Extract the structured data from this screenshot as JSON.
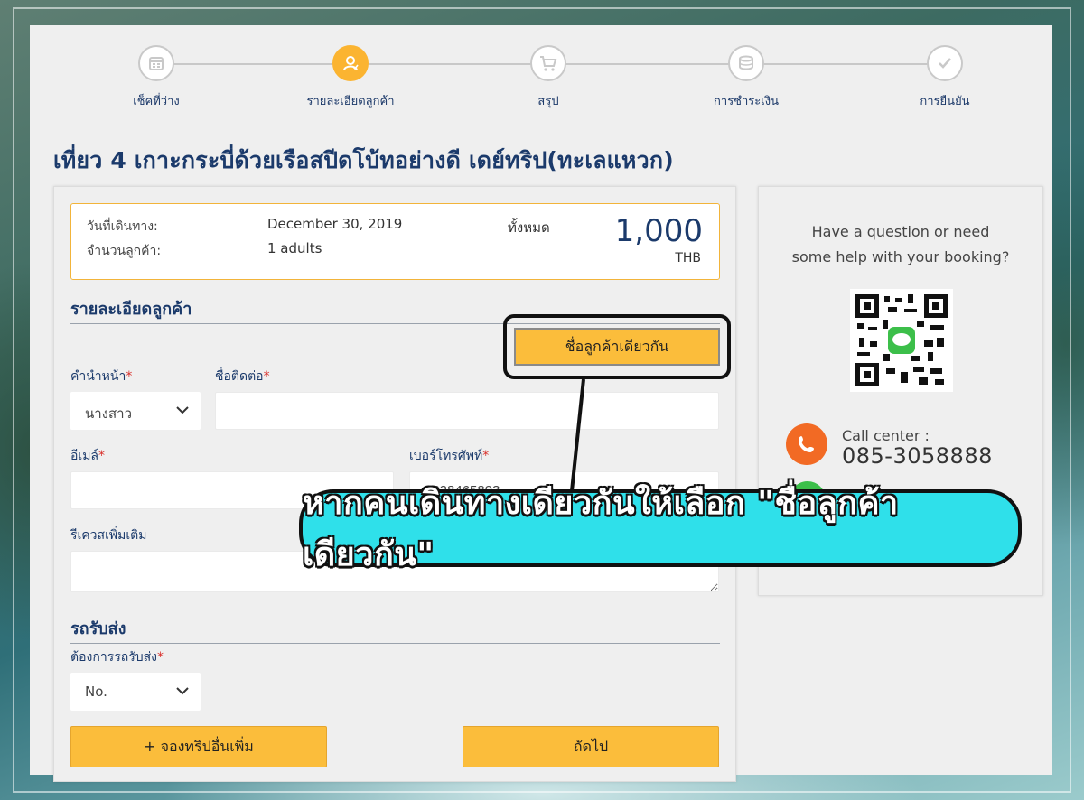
{
  "steps": [
    {
      "label": "เช็คที่ว่าง",
      "icon": "calendar-icon",
      "active": false
    },
    {
      "label": "รายละเอียดลูกค้า",
      "icon": "user-icon",
      "active": true
    },
    {
      "label": "สรุป",
      "icon": "cart-icon",
      "active": false
    },
    {
      "label": "การชำระเงิน",
      "icon": "coins-icon",
      "active": false
    },
    {
      "label": "การยืนยัน",
      "icon": "check-icon",
      "active": false
    }
  ],
  "title": "เที่ยว 4 เกาะกระบี่ด้วยเรือสปีดโบ้ทอย่างดี เดย์ทริป(ทะเลแหวก)",
  "summary": {
    "date_label": "วันที่เดินทาง:",
    "date_value": "December 30, 2019",
    "guests_label": "จำนวนลูกค้า:",
    "guests_value": "1 adults",
    "total_label": "ทั้งหมด",
    "price": "1,000",
    "currency": "THB"
  },
  "customer": {
    "section_title": "รายละเอียดลูกค้า",
    "same_name_button": "ชื่อลูกค้าเดียวกัน",
    "prefix_label": "คำนำหน้า",
    "prefix_value": "นางสาว",
    "contact_name_label": "ชื่อติดต่อ",
    "contact_name_value": "",
    "email_label": "อีเมล์",
    "email_value": "",
    "phone_label": "เบอร์โทรศัพท์",
    "phone_value": "0628465893",
    "request_label": "รีเควสเพิ่มเติม",
    "request_value": "",
    "required_mark": "*"
  },
  "transfer": {
    "section_title": "รถรับส่ง",
    "need_label": "ต้องการรถรับส่ง",
    "need_value": "No."
  },
  "buttons": {
    "add_trip": "+ จองทริปอื่นเพิ่ม",
    "next": "ถัดไป"
  },
  "callout": "หากคนเดินทางเดียวกันให้เลือก  \"ชื่อลูกค้าเดียวกัน\"",
  "side": {
    "help_line1": "Have a question or need",
    "help_line2": "some help with your booking?",
    "call_center_label": "Call center :",
    "call_center_number": "085-3058888"
  },
  "colors": {
    "accent": "#fbbd3b",
    "navy": "#1b3a6b",
    "callout": "#2fe0ea",
    "phone_icon": "#f26a24",
    "line_green": "#3cbf4a"
  }
}
